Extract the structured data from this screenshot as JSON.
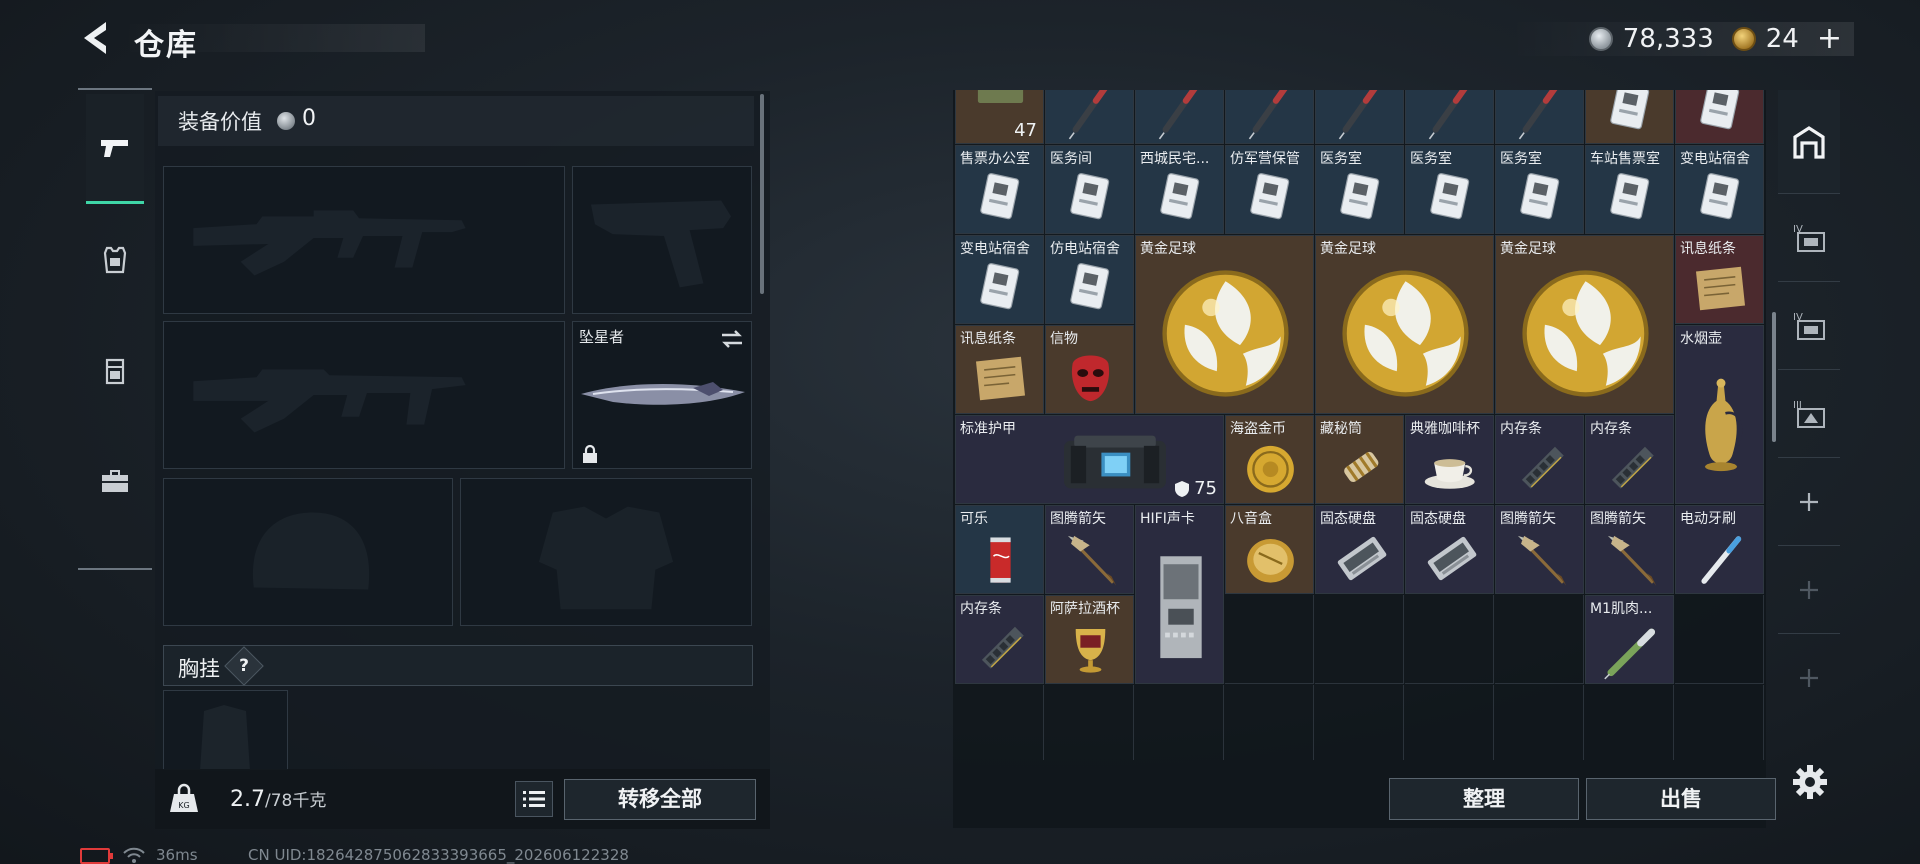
{
  "header": {
    "title": "仓库"
  },
  "currency": {
    "silver": "78,333",
    "gold": "24",
    "add": "+"
  },
  "equipment": {
    "value_label": "装备价值",
    "value": "0",
    "melee_name": "坠星者",
    "chest_label": "胸挂",
    "chest_help": "?"
  },
  "weight": {
    "current": "2.7",
    "max": "/78千克"
  },
  "buttons": {
    "transfer_all": "转移全部",
    "sort": "整理",
    "sell": "出售"
  },
  "stash": {
    "items": [
      {
        "name": "",
        "q": "q-gold",
        "icon": "ammo",
        "count": "47",
        "c": 0,
        "r": -1,
        "w": 1,
        "h": 1
      },
      {
        "name": "",
        "q": "q-blue",
        "icon": "injector",
        "c": 1,
        "r": -1,
        "w": 1,
        "h": 1
      },
      {
        "name": "",
        "q": "q-blue",
        "icon": "injector",
        "c": 2,
        "r": -1,
        "w": 1,
        "h": 1
      },
      {
        "name": "",
        "q": "q-blue",
        "icon": "injector",
        "c": 3,
        "r": -1,
        "w": 1,
        "h": 1
      },
      {
        "name": "",
        "q": "q-blue",
        "icon": "injector",
        "c": 4,
        "r": -1,
        "w": 1,
        "h": 1
      },
      {
        "name": "",
        "q": "q-blue",
        "icon": "injector",
        "c": 5,
        "r": -1,
        "w": 1,
        "h": 1
      },
      {
        "name": "",
        "q": "q-blue",
        "icon": "injector",
        "c": 6,
        "r": -1,
        "w": 1,
        "h": 1
      },
      {
        "name": "",
        "q": "q-gold",
        "icon": "keycard",
        "c": 7,
        "r": -1,
        "w": 1,
        "h": 1
      },
      {
        "name": "",
        "q": "q-red",
        "icon": "keycard",
        "c": 8,
        "r": -1,
        "w": 1,
        "h": 1
      },
      {
        "name": "售票办公室",
        "q": "q-blue",
        "icon": "keycard",
        "c": 0,
        "r": 0,
        "w": 1,
        "h": 1
      },
      {
        "name": "医务间",
        "q": "q-blue",
        "icon": "keycard",
        "c": 1,
        "r": 0,
        "w": 1,
        "h": 1
      },
      {
        "name": "西城民宅...",
        "q": "q-blue",
        "icon": "keycard",
        "c": 2,
        "r": 0,
        "w": 1,
        "h": 1
      },
      {
        "name": "仿军营保管",
        "q": "q-blue",
        "icon": "keycard",
        "c": 3,
        "r": 0,
        "w": 1,
        "h": 1
      },
      {
        "name": "医务室",
        "q": "q-blue",
        "icon": "keycard",
        "c": 4,
        "r": 0,
        "w": 1,
        "h": 1
      },
      {
        "name": "医务室",
        "q": "q-blue",
        "icon": "keycard",
        "c": 5,
        "r": 0,
        "w": 1,
        "h": 1
      },
      {
        "name": "医务室",
        "q": "q-blue",
        "icon": "keycard",
        "c": 6,
        "r": 0,
        "w": 1,
        "h": 1
      },
      {
        "name": "车站售票室",
        "q": "q-blue",
        "icon": "keycard",
        "c": 7,
        "r": 0,
        "w": 1,
        "h": 1
      },
      {
        "name": "变电站宿舍",
        "q": "q-blue",
        "icon": "keycard",
        "c": 8,
        "r": 0,
        "w": 1,
        "h": 1
      },
      {
        "name": "变电站宿舍",
        "q": "q-blue",
        "icon": "keycard",
        "c": 0,
        "r": 1,
        "w": 1,
        "h": 1
      },
      {
        "name": "仿电站宿舍",
        "q": "q-blue",
        "icon": "keycard",
        "c": 1,
        "r": 1,
        "w": 1,
        "h": 1
      },
      {
        "name": "黄金足球",
        "q": "q-gold",
        "icon": "ball",
        "c": 2,
        "r": 1,
        "w": 2,
        "h": 2
      },
      {
        "name": "黄金足球",
        "q": "q-gold",
        "icon": "ball",
        "c": 4,
        "r": 1,
        "w": 2,
        "h": 2
      },
      {
        "name": "黄金足球",
        "q": "q-gold",
        "icon": "ball",
        "c": 6,
        "r": 1,
        "w": 2,
        "h": 2
      },
      {
        "name": "讯息纸条",
        "q": "q-red",
        "icon": "note",
        "c": 8,
        "r": 1,
        "w": 1,
        "h": 1
      },
      {
        "name": "讯息纸条",
        "q": "q-gold",
        "icon": "note",
        "c": 0,
        "r": 2,
        "w": 1,
        "h": 1
      },
      {
        "name": "信物",
        "q": "q-gold",
        "icon": "mask",
        "c": 1,
        "r": 2,
        "w": 1,
        "h": 1
      },
      {
        "name": "水烟壶",
        "q": "q-purple",
        "icon": "hookah",
        "c": 8,
        "r": 2,
        "w": 1,
        "h": 2
      },
      {
        "name": "标准护甲",
        "q": "q-purple",
        "icon": "armor",
        "armor": "75",
        "c": 0,
        "r": 3,
        "w": 3,
        "h": 1
      },
      {
        "name": "海盗金币",
        "q": "q-gold",
        "icon": "coin",
        "c": 3,
        "r": 3,
        "w": 1,
        "h": 1
      },
      {
        "name": "藏秘筒",
        "q": "q-gold",
        "icon": "cryptex",
        "c": 4,
        "r": 3,
        "w": 1,
        "h": 1
      },
      {
        "name": "典雅咖啡杯",
        "q": "q-purple",
        "icon": "cup",
        "c": 5,
        "r": 3,
        "w": 1,
        "h": 1
      },
      {
        "name": "内存条",
        "q": "q-purple",
        "icon": "ram",
        "c": 6,
        "r": 3,
        "w": 1,
        "h": 1
      },
      {
        "name": "内存条",
        "q": "q-purple",
        "icon": "ram",
        "c": 7,
        "r": 3,
        "w": 1,
        "h": 1
      },
      {
        "name": "可乐",
        "q": "q-blue",
        "icon": "cola",
        "c": 0,
        "r": 4,
        "w": 1,
        "h": 1
      },
      {
        "name": "图腾箭矢",
        "q": "q-purple",
        "icon": "arrow",
        "c": 1,
        "r": 4,
        "w": 1,
        "h": 1
      },
      {
        "name": "HIFI声卡",
        "q": "q-purple",
        "icon": "card",
        "c": 2,
        "r": 4,
        "w": 1,
        "h": 2
      },
      {
        "name": "八音盒",
        "q": "q-gold",
        "icon": "musicbox",
        "c": 3,
        "r": 4,
        "w": 1,
        "h": 1
      },
      {
        "name": "固态硬盘",
        "q": "q-purple",
        "icon": "ssd",
        "c": 4,
        "r": 4,
        "w": 1,
        "h": 1
      },
      {
        "name": "固态硬盘",
        "q": "q-purple",
        "icon": "ssd",
        "c": 5,
        "r": 4,
        "w": 1,
        "h": 1
      },
      {
        "name": "图腾箭矢",
        "q": "q-purple",
        "icon": "arrow",
        "c": 6,
        "r": 4,
        "w": 1,
        "h": 1
      },
      {
        "name": "图腾箭矢",
        "q": "q-purple",
        "icon": "arrow",
        "c": 7,
        "r": 4,
        "w": 1,
        "h": 1
      },
      {
        "name": "电动牙刷",
        "q": "q-purple",
        "icon": "toothbrush",
        "c": 8,
        "r": 4,
        "w": 1,
        "h": 1
      },
      {
        "name": "内存条",
        "q": "q-purple",
        "icon": "ram",
        "c": 0,
        "r": 5,
        "w": 1,
        "h": 1
      },
      {
        "name": "阿萨拉酒杯",
        "q": "q-gold",
        "icon": "goblet",
        "c": 1,
        "r": 5,
        "w": 1,
        "h": 1
      },
      {
        "name": "M1肌肉...",
        "q": "q-purple",
        "icon": "syringe",
        "c": 7,
        "r": 5,
        "w": 1,
        "h": 1
      }
    ]
  },
  "status": {
    "ping": "36ms",
    "uid": "CN UID:1826428750628333936​65_202606122328"
  }
}
